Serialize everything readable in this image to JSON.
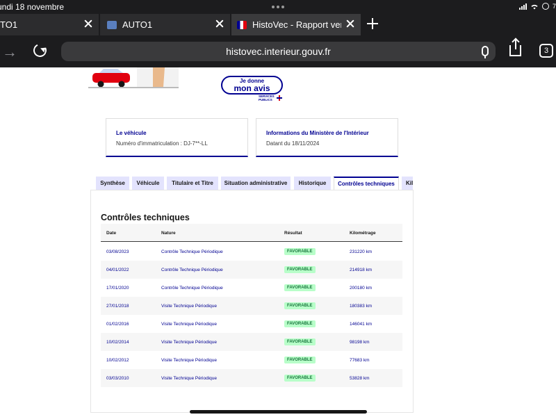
{
  "status": {
    "time": "undi 18 novembre",
    "battery": "7"
  },
  "browser": {
    "tabs": [
      {
        "label": "TO1",
        "favicon": "generic-icon"
      },
      {
        "label": "AUTO1",
        "favicon": "auto1-icon"
      },
      {
        "label": "HistoVec - Rapport vende",
        "favicon": "french-flag-icon"
      }
    ],
    "url": "histovec.interieur.gouv.fr",
    "tab_count": "3"
  },
  "page": {
    "avis": {
      "line1": "Je donne",
      "line2": "mon avis"
    },
    "services_publics": "SERVICES PUBLICS",
    "cards": [
      {
        "title": "Le véhicule",
        "text": "Numéro d'immatriculation : DJ-7**-LL"
      },
      {
        "title": "Informations du Ministère de l'Intérieur",
        "text": "Datant du 18/11/2024"
      }
    ],
    "tabs": [
      "Synthèse",
      "Véhicule",
      "Titulaire et Titre",
      "Situation administrative",
      "Historique",
      "Contrôles techniques",
      "Kilo"
    ],
    "section_title": "Contrôles techniques",
    "table": {
      "headers": [
        "Date",
        "Nature",
        "Résultat",
        "Kilométrage"
      ],
      "rows": [
        [
          "03/08/2023",
          "Contrôle Technique Périodique",
          "FAVORABLE",
          "231220 km"
        ],
        [
          "04/01/2022",
          "Contrôle Technique Périodique",
          "FAVORABLE",
          "214918 km"
        ],
        [
          "17/01/2020",
          "Contrôle Technique Périodique",
          "FAVORABLE",
          "200180 km"
        ],
        [
          "27/01/2018",
          "Visite Technique Périodique",
          "FAVORABLE",
          "180383 km"
        ],
        [
          "01/02/2016",
          "Visite Technique Périodique",
          "FAVORABLE",
          "146041 km"
        ],
        [
          "10/02/2014",
          "Visite Technique Périodique",
          "FAVORABLE",
          "98198 km"
        ],
        [
          "10/02/2012",
          "Visite Technique Périodique",
          "FAVORABLE",
          "77683 km"
        ],
        [
          "03/03/2010",
          "Visite Technique Périodique",
          "FAVORABLE",
          "53828 km"
        ]
      ]
    }
  },
  "colors": {
    "accent": "#000091",
    "success_bg": "#b8fec9",
    "success_text": "#18753c",
    "chrome": "#1c1c1e"
  }
}
